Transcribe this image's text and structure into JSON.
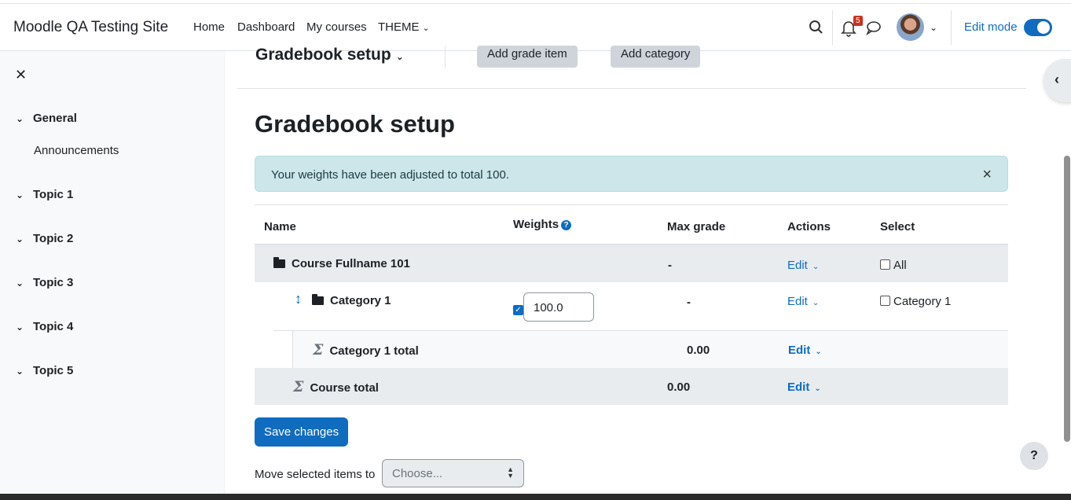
{
  "navbar": {
    "brand": "Moodle QA Testing Site",
    "links": [
      "Home",
      "Dashboard",
      "My courses",
      "THEME"
    ],
    "notification_count": "5",
    "edit_mode_label": "Edit mode"
  },
  "drawer": {
    "sections": [
      {
        "label": "General",
        "items": [
          "Announcements"
        ]
      },
      {
        "label": "Topic 1"
      },
      {
        "label": "Topic 2"
      },
      {
        "label": "Topic 3"
      },
      {
        "label": "Topic 4"
      },
      {
        "label": "Topic 5"
      }
    ]
  },
  "sticky": {
    "title": "Gradebook setup",
    "add_grade_item": "Add grade item",
    "add_category": "Add category"
  },
  "page_title": "Gradebook setup",
  "alert": {
    "text": "Your weights have been adjusted to total 100."
  },
  "table": {
    "headers": {
      "name": "Name",
      "weights": "Weights",
      "max_grade": "Max grade",
      "actions": "Actions",
      "select": "Select"
    },
    "rows": [
      {
        "name": "Course Fullname 101",
        "max_grade": "-",
        "action": "Edit",
        "select": "All"
      },
      {
        "name": "Category 1",
        "weight": "100.0",
        "weight_checked": true,
        "max_grade": "-",
        "action": "Edit",
        "select": "Category 1"
      },
      {
        "name": "Category 1 total",
        "max_grade": "0.00",
        "action": "Edit"
      },
      {
        "name": "Course total",
        "max_grade": "0.00",
        "action": "Edit"
      }
    ]
  },
  "save_button": "Save changes",
  "move_label": "Move selected items to",
  "move_select_placeholder": "Choose...",
  "help_button": "?",
  "colors": {
    "primary": "#0f6cbf",
    "alert_bg": "#cce6ea",
    "badge": "#ca3120"
  }
}
